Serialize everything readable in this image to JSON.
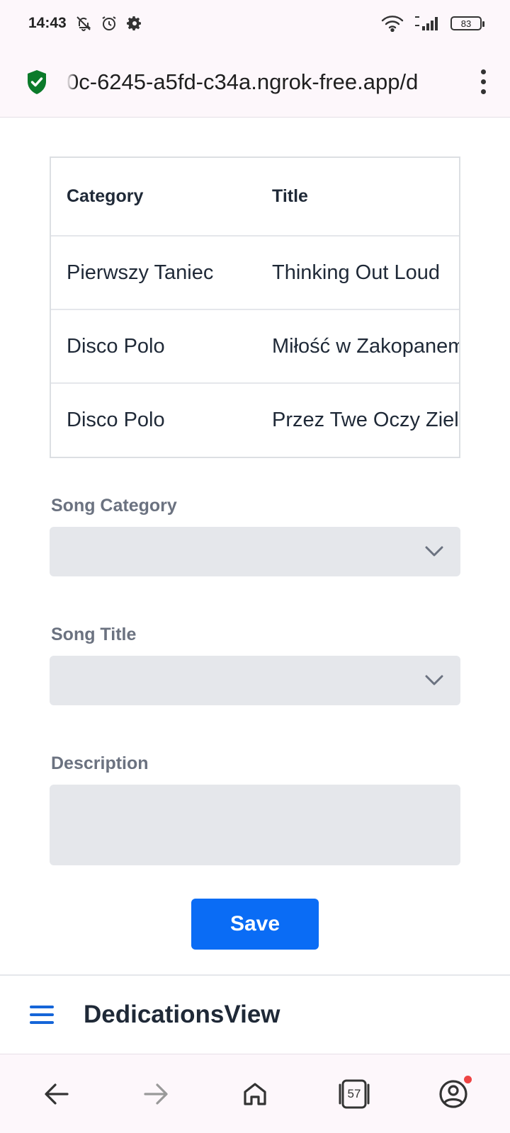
{
  "status_bar": {
    "time": "14:43",
    "battery": "83"
  },
  "browser": {
    "url": "0c-6245-a5fd-c34a.ngrok-free.app/d",
    "tab_count": "57"
  },
  "table": {
    "columns": [
      "Category",
      "Title"
    ],
    "rows": [
      [
        "Pierwszy Taniec",
        "Thinking Out Loud"
      ],
      [
        "Disco Polo",
        "Miłość w Zakopanem"
      ],
      [
        "Disco Polo",
        "Przez Twe Oczy Zielone"
      ]
    ]
  },
  "form": {
    "song_category_label": "Song Category",
    "song_category_value": "",
    "song_title_label": "Song Title",
    "song_title_value": "",
    "description_label": "Description",
    "description_value": "",
    "save_label": "Save"
  },
  "app_bar": {
    "title": "DedicationsView"
  },
  "colors": {
    "primary": "#0a6cf5",
    "menu_icon": "#1565d8",
    "shield": "#0b7a2a",
    "field_bg": "#e5e7eb",
    "notification_dot": "#ee4444"
  },
  "icons": {
    "status_left": [
      "bell-off-icon",
      "alarm-icon",
      "gear-icon"
    ],
    "status_right": [
      "wifi-icon",
      "signal-icon",
      "battery-icon"
    ],
    "url": [
      "shield-check-icon",
      "more-vert-icon"
    ],
    "nav": [
      "back-icon",
      "forward-icon",
      "home-icon",
      "tabs-icon",
      "account-icon"
    ]
  }
}
